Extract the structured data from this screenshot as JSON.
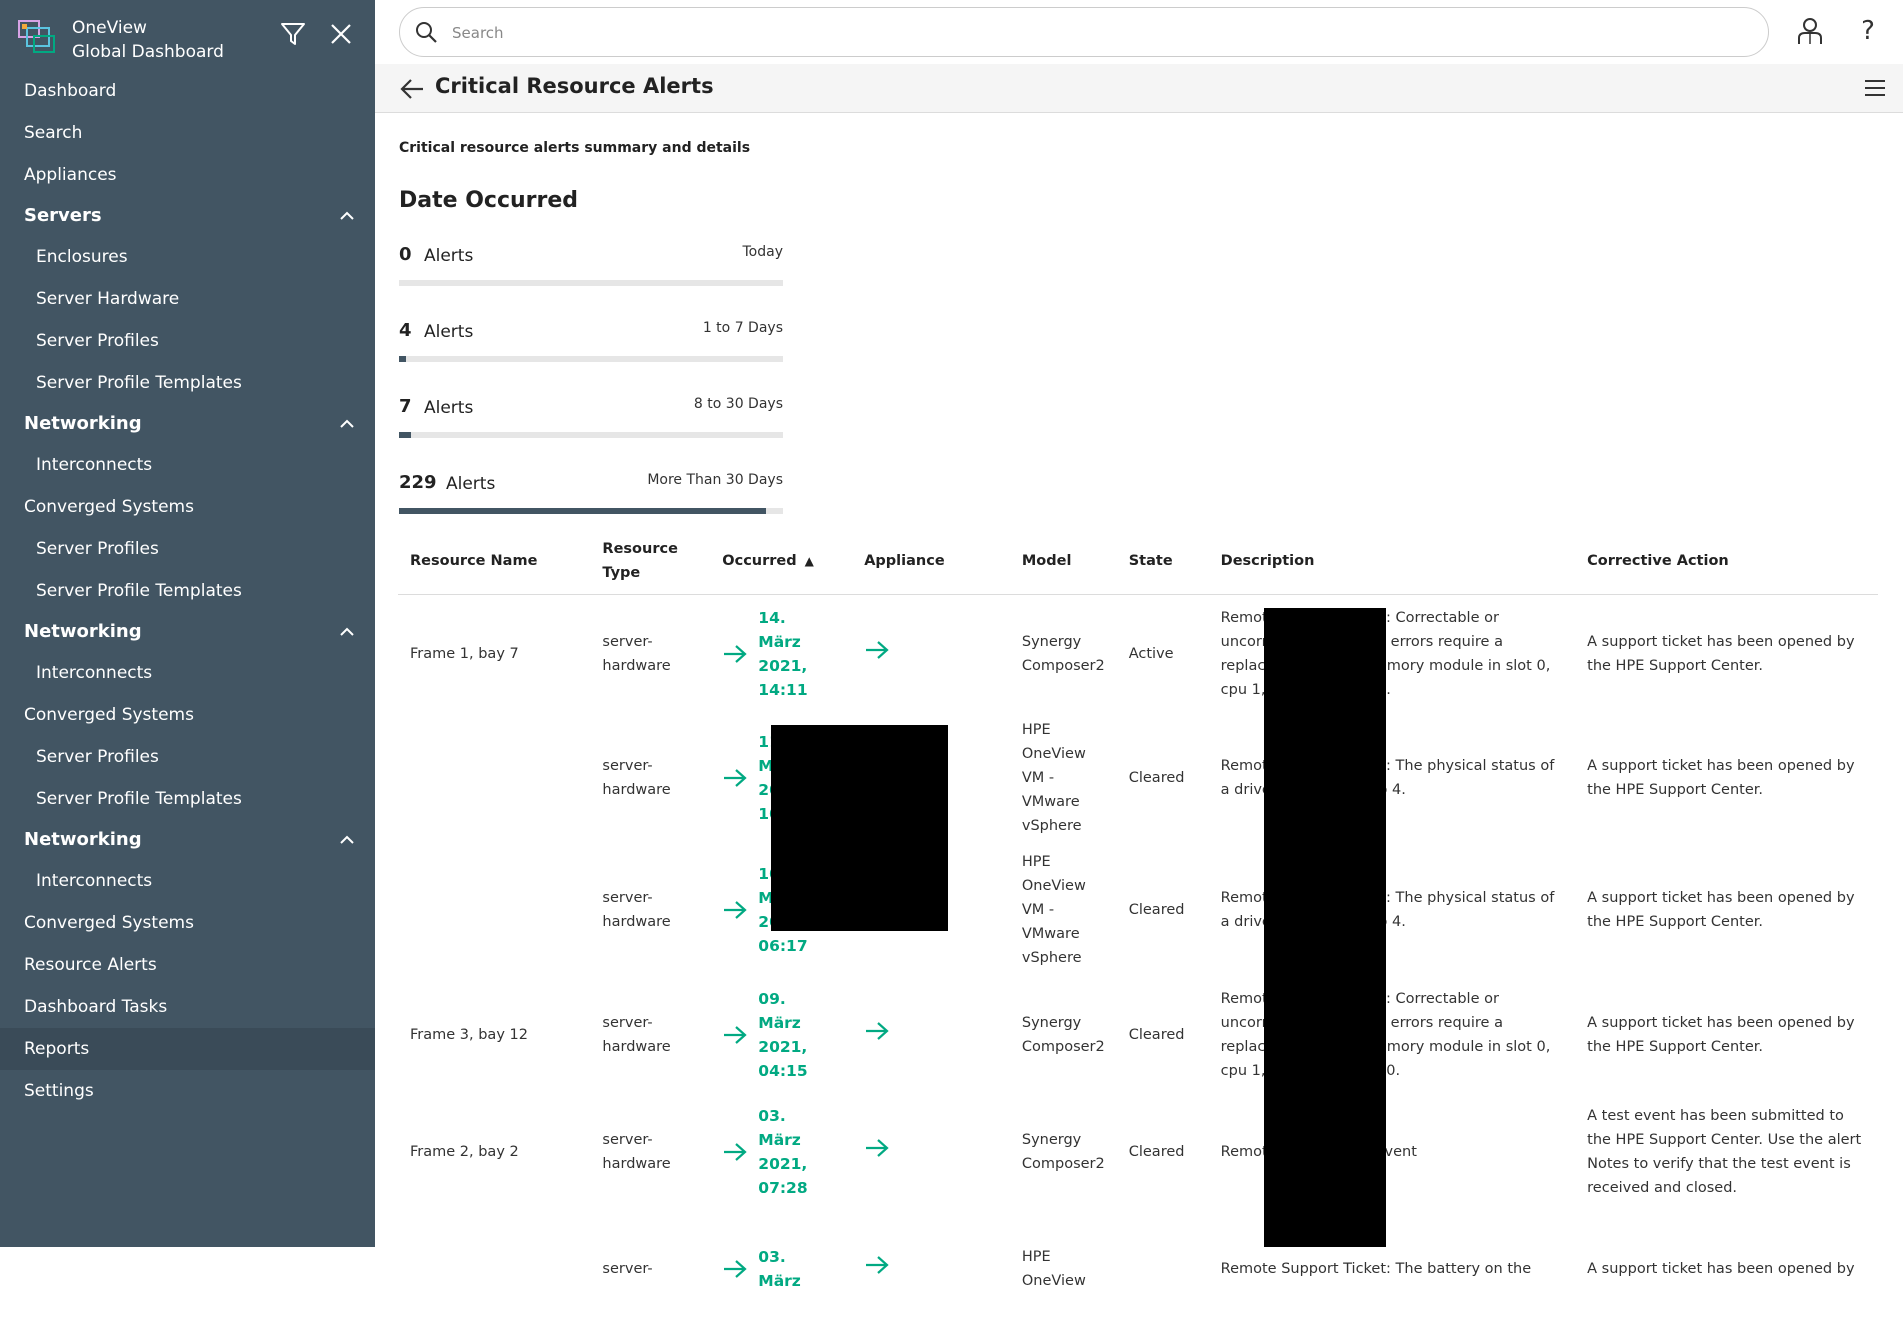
{
  "app": {
    "name_line1": "OneView",
    "name_line2": "Global Dashboard"
  },
  "sidebar": {
    "items": [
      {
        "label": "Dashboard",
        "kind": "top"
      },
      {
        "label": "Search",
        "kind": "top"
      },
      {
        "label": "Appliances",
        "kind": "top"
      },
      {
        "label": "Servers",
        "kind": "group"
      },
      {
        "label": "Enclosures",
        "kind": "sub"
      },
      {
        "label": "Server Hardware",
        "kind": "sub"
      },
      {
        "label": "Server Profiles",
        "kind": "sub"
      },
      {
        "label": "Server Profile Templates",
        "kind": "sub"
      },
      {
        "label": "Networking",
        "kind": "group"
      },
      {
        "label": "Interconnects",
        "kind": "sub"
      },
      {
        "label": "Converged Systems",
        "kind": "top"
      },
      {
        "label": "Server Profiles",
        "kind": "sub"
      },
      {
        "label": "Server Profile Templates",
        "kind": "sub"
      },
      {
        "label": "Networking",
        "kind": "group"
      },
      {
        "label": "Interconnects",
        "kind": "sub"
      },
      {
        "label": "Converged Systems",
        "kind": "top"
      },
      {
        "label": "Server Profiles",
        "kind": "sub"
      },
      {
        "label": "Server Profile Templates",
        "kind": "sub"
      },
      {
        "label": "Networking",
        "kind": "group"
      },
      {
        "label": "Interconnects",
        "kind": "sub"
      },
      {
        "label": "Converged Systems",
        "kind": "top"
      },
      {
        "label": "Resource Alerts",
        "kind": "top"
      },
      {
        "label": "Dashboard Tasks",
        "kind": "top"
      },
      {
        "label": "Reports",
        "kind": "top",
        "active": true
      },
      {
        "label": "Settings",
        "kind": "top"
      }
    ]
  },
  "search": {
    "placeholder": "Search"
  },
  "header": {
    "title": "Critical Resource Alerts"
  },
  "main": {
    "subtitle": "Critical resource alerts summary and details",
    "section_title": "Date Occurred",
    "stats": [
      {
        "count": "0",
        "unit": "Alerts",
        "range": "Today",
        "fill_fraction": 0.0
      },
      {
        "count": "4",
        "unit": "Alerts",
        "range": "1 to 7 Days",
        "fill_fraction": 0.017
      },
      {
        "count": "7",
        "unit": "Alerts",
        "range": "8 to 30 Days",
        "fill_fraction": 0.03
      },
      {
        "count": "229",
        "unit": "Alerts",
        "range": "More Than 30 Days",
        "fill_fraction": 0.955
      }
    ]
  },
  "table": {
    "columns": {
      "resource_name": "Resource Name",
      "resource_type": "Resource Type",
      "occurred": "Occurred",
      "appliance": "Appliance",
      "model": "Model",
      "state": "State",
      "description": "Description",
      "corrective_action": "Corrective Action"
    },
    "sort_indicator": "▲",
    "rows": [
      {
        "name": "Frame 1, bay 7",
        "type": "server-hardware",
        "occurred": "14. März 2021, 14:11",
        "model": "Synergy Composer2",
        "state": "Active",
        "description": "Remote Support Ticket: Correctable or uncorrectable memory errors require a replacement of the memory module in slot 0, cpu 1, riser 0, socket 1.",
        "action": "A support ticket has been opened by the HPE Support Center."
      },
      {
        "name": "",
        "type": "server-hardware",
        "occurred": "11. März 2021, 10:22",
        "model": "HPE OneView VM - VMware vSphere",
        "state": "Cleared",
        "description": "Remote Support Ticket: The physical status of a drive has changed to 4.",
        "action": "A support ticket has been opened by the HPE Support Center."
      },
      {
        "name": "",
        "type": "server-hardware",
        "occurred": "10. März 2021, 06:17",
        "model": "HPE OneView VM - VMware vSphere",
        "state": "Cleared",
        "description": "Remote Support Ticket: The physical status of a drive has changed to 4.",
        "action": "A support ticket has been opened by the HPE Support Center."
      },
      {
        "name": "Frame 3, bay 12",
        "type": "server-hardware",
        "occurred": "09. März 2021, 04:15",
        "model": "Synergy Composer2",
        "state": "Cleared",
        "description": "Remote Support Ticket: Correctable or uncorrectable memory errors require a replacement of the memory module in slot 0, cpu 1, riser 0, socket 10.",
        "action": "A support ticket has been opened by the HPE Support Center."
      },
      {
        "name": "Frame 2, bay 2",
        "type": "server-hardware",
        "occurred": "03. März 2021, 07:28",
        "model": "Synergy Composer2",
        "state": "Cleared",
        "description": "Remote Support test event",
        "action": "A test event has been submitted to the HPE Support Center. Use the alert Notes to verify that the test event is received and closed."
      },
      {
        "name": "",
        "type": "server-",
        "occurred": "03. März",
        "model": "HPE OneView",
        "state": "",
        "description": "Remote Support Ticket: The battery on the",
        "action": "A support ticket has been opened by"
      }
    ]
  },
  "colors": {
    "sidebar_bg": "#425563",
    "accent": "#01a982",
    "progress_fill": "#425563"
  }
}
